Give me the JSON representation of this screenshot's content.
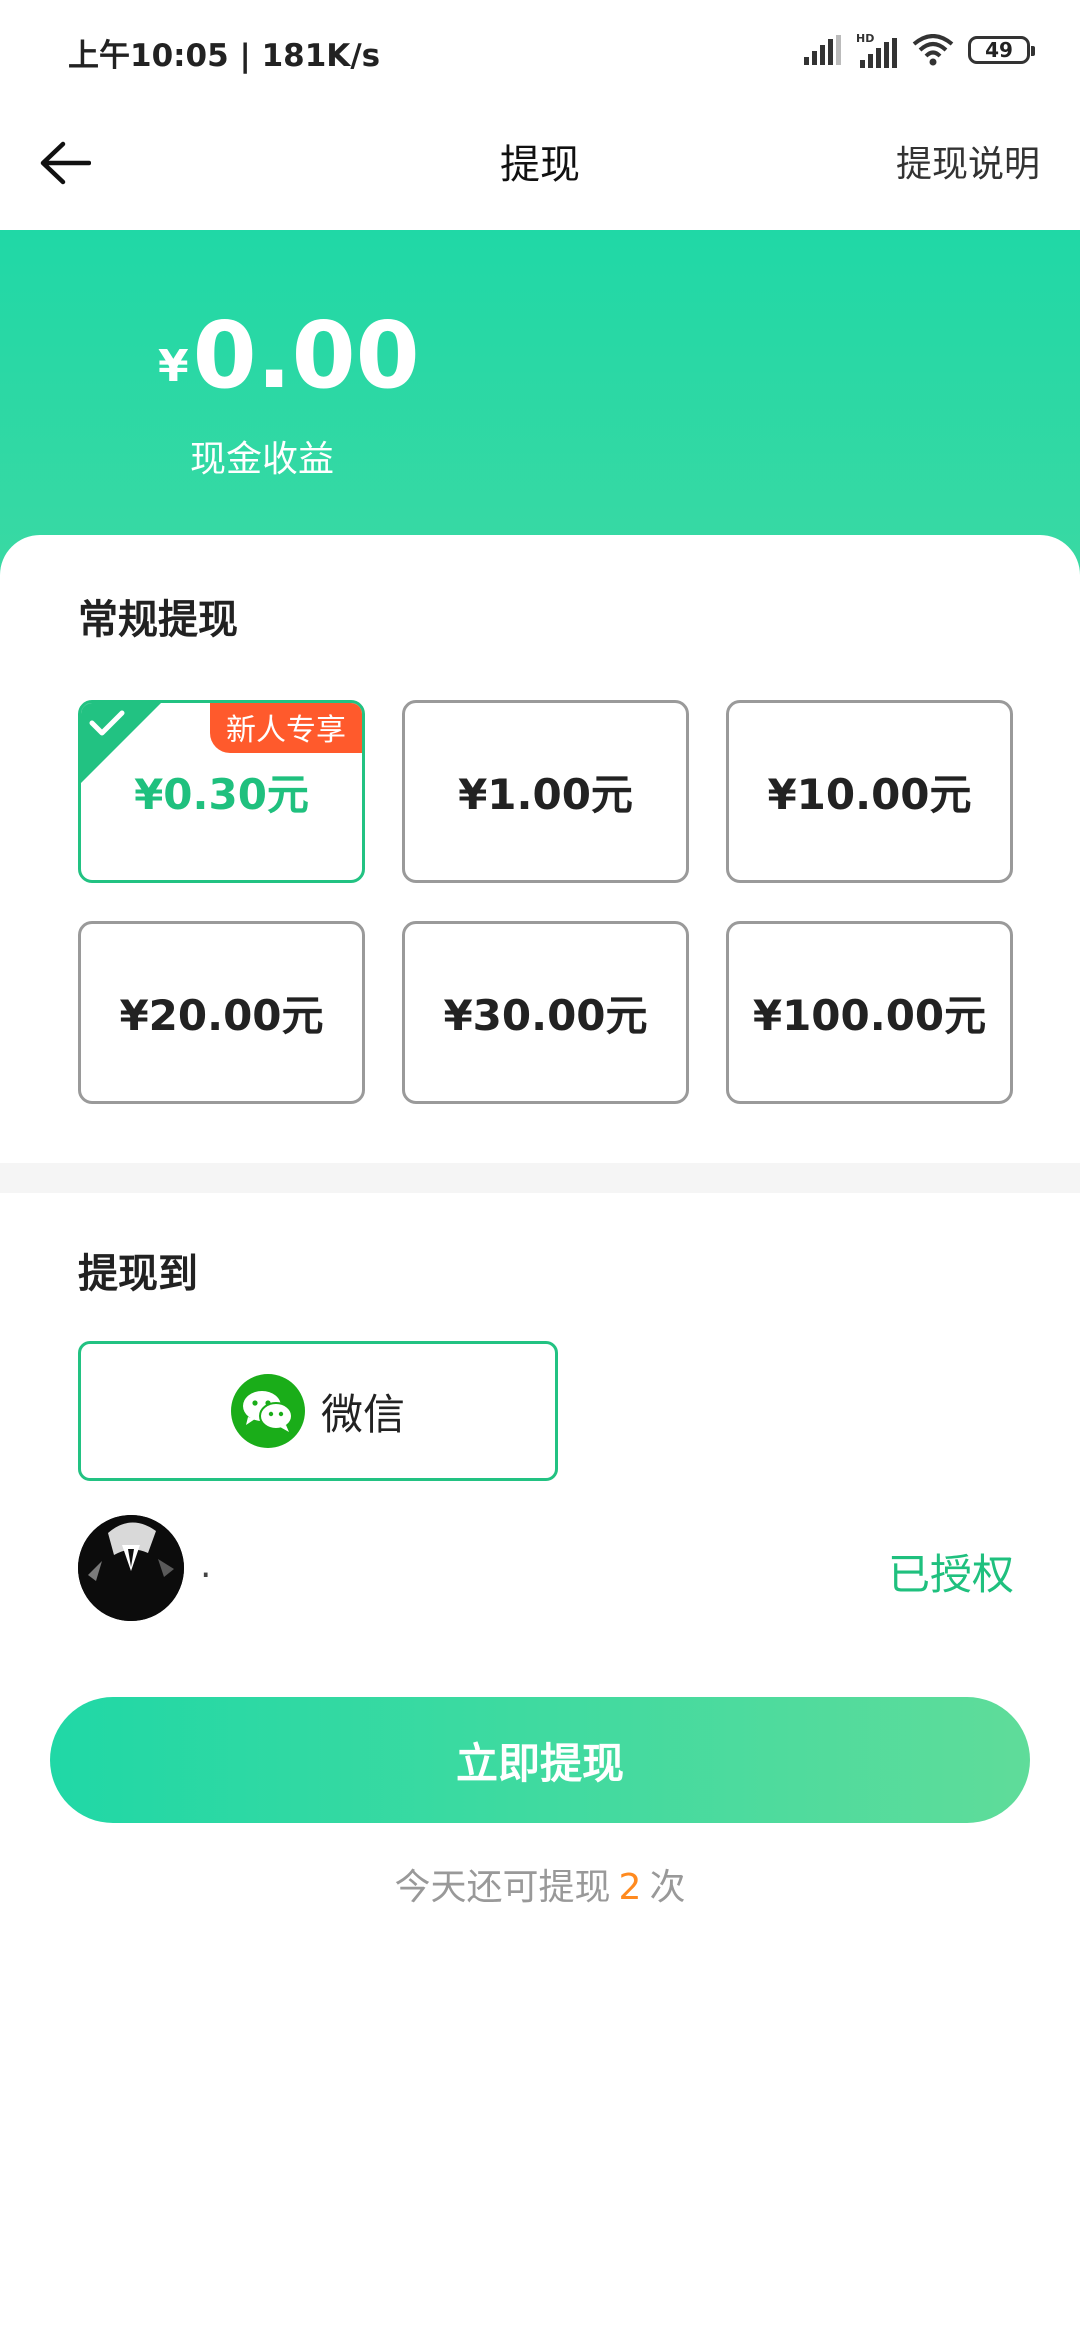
{
  "status_bar": {
    "time": "上午10:05 | 181K/s",
    "battery": "49"
  },
  "appbar": {
    "title": "提现",
    "right_link": "提现说明"
  },
  "balance": {
    "currency_symbol": "¥",
    "amount": "0.00",
    "label": "现金收益"
  },
  "regular_withdraw": {
    "title": "常规提现",
    "options": [
      {
        "label": "¥0.30元",
        "selected": true,
        "badge": "新人专享"
      },
      {
        "label": "¥1.00元",
        "selected": false
      },
      {
        "label": "¥10.00元",
        "selected": false
      },
      {
        "label": "¥20.00元",
        "selected": false
      },
      {
        "label": "¥30.00元",
        "selected": false
      },
      {
        "label": "¥100.00元",
        "selected": false
      }
    ]
  },
  "withdraw_to": {
    "title": "提现到",
    "method": "微信"
  },
  "account": {
    "name": ".",
    "status": "已授权"
  },
  "submit": {
    "label": "立即提现"
  },
  "remaining": {
    "prefix": "今天还可提现",
    "count": "2",
    "suffix": "次"
  },
  "colors": {
    "accent": "#22c282",
    "hero": "#20d8a6",
    "badge": "#ff5a2c",
    "count": "#ff8a1f",
    "wechat": "#1aad19"
  }
}
